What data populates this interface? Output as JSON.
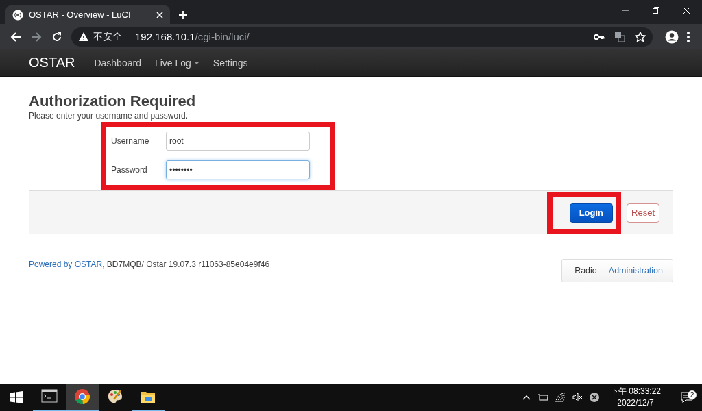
{
  "browser": {
    "tab": {
      "title": "OSTAR - Overview - LuCI",
      "selected": true
    },
    "security_label": "不安全",
    "url_host": "192.168.10.1",
    "url_path": "/cgi-bin/luci/"
  },
  "navbar": {
    "brand": "OSTAR",
    "items": [
      {
        "label": "Dashboard",
        "dropdown": false
      },
      {
        "label": "Live Log",
        "dropdown": true
      },
      {
        "label": "Settings",
        "dropdown": false
      }
    ]
  },
  "page": {
    "title": "Authorization Required",
    "description": "Please enter your username and password.",
    "fields": [
      {
        "label": "Username",
        "value": "root",
        "focused": false
      },
      {
        "label": "Password",
        "value": "••••••••",
        "focused": true
      }
    ],
    "fields_highlighted": true,
    "buttons": [
      {
        "label": "Login",
        "kind": "primary",
        "highlighted": true
      },
      {
        "label": "Reset",
        "kind": "reset",
        "highlighted": false
      }
    ]
  },
  "footer": {
    "link": "Powered by OSTAR",
    "text": ", BD7MQB/ Ostar 19.07.3 r11063-85e04e9f46",
    "menu": [
      {
        "label": "Radio",
        "selected": true
      },
      {
        "label": "Administration",
        "selected": false
      }
    ]
  },
  "taskbar": {
    "apps": [
      {
        "kind": "terminal",
        "running": true,
        "selected": false
      },
      {
        "kind": "browser",
        "running": true,
        "selected": true
      },
      {
        "kind": "paint",
        "running": false,
        "selected": false
      },
      {
        "kind": "folder",
        "running": true,
        "selected": false
      }
    ],
    "time": "下午 08:33:22",
    "date": "2022/12/7",
    "notifications": "2"
  }
}
